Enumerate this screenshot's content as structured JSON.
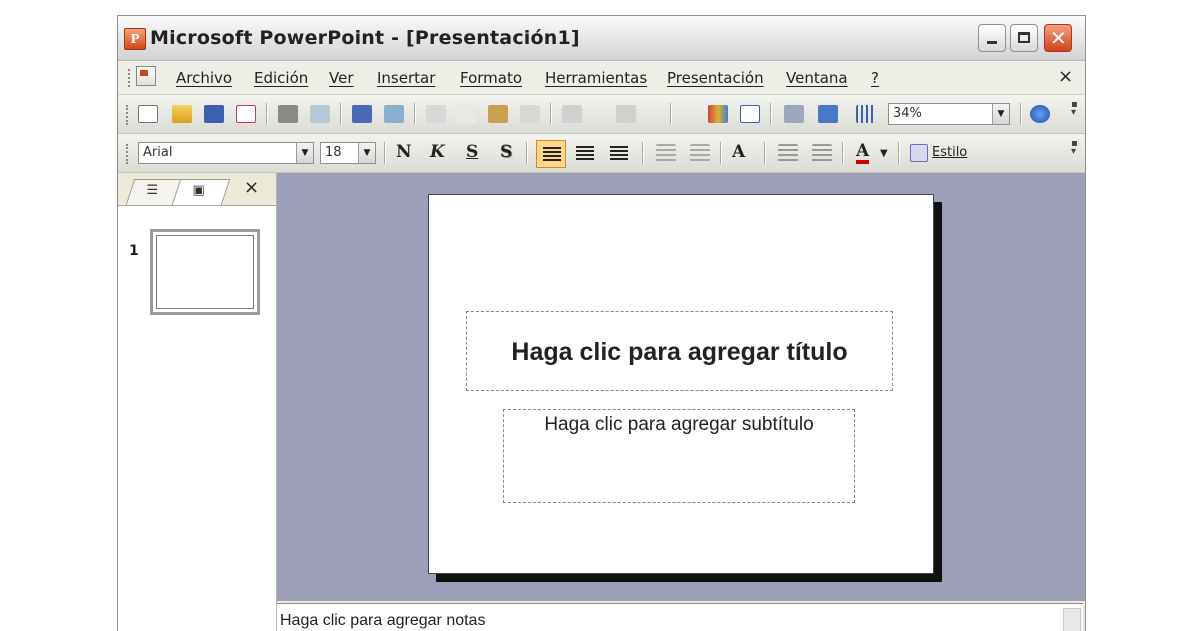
{
  "window": {
    "title": "Microsoft PowerPoint - [Presentación1]",
    "app_icon_letter": "P"
  },
  "menubar": {
    "items": [
      "Archivo",
      "Edición",
      "Ver",
      "Insertar",
      "Formato",
      "Herramientas",
      "Presentación",
      "Ventana",
      "?"
    ],
    "close_glyph": "×"
  },
  "standard_toolbar": {
    "icons": [
      "new-icon",
      "open-icon",
      "save-icon",
      "permission-icon",
      "print-icon",
      "print-preview-icon",
      "spelling-icon",
      "research-icon",
      "cut-icon",
      "copy-icon",
      "paste-icon",
      "format-painter-icon",
      "undo-icon",
      "redo-icon",
      "insert-chart-icon",
      "insert-table-icon",
      "tables-borders-icon",
      "expand-all-icon",
      "show-grid-icon",
      "help-icon"
    ],
    "zoom": "34%"
  },
  "format_toolbar": {
    "font": "Arial",
    "size": "18",
    "bold": "N",
    "italic": "K",
    "underline": "S",
    "shadow": "S",
    "style_label": "Estilo",
    "font_color": "A",
    "grow_font": "A"
  },
  "left_pane": {
    "slide_number": "1",
    "close_glyph": "×"
  },
  "slide": {
    "title_placeholder": "Haga clic para agregar título",
    "subtitle_placeholder": "Haga clic para agregar subtítulo"
  },
  "notes": {
    "placeholder": "Haga clic para agregar notas"
  },
  "colors": {
    "workspace": "#9d9eb8",
    "active_button": "#ffd68a",
    "close_button": "#d0421c"
  }
}
